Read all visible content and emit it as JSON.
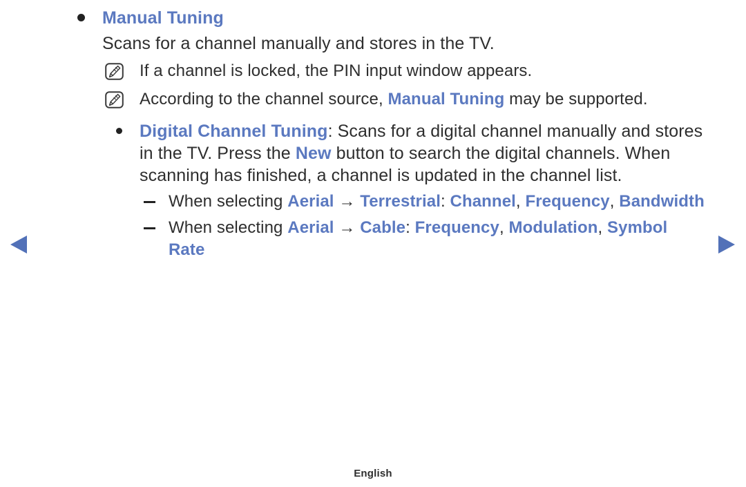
{
  "nav": {
    "prev_label": "previous-page",
    "next_label": "next-page",
    "arrow_color": "#5271b8"
  },
  "colors": {
    "accent_blue": "#5b79c0",
    "text_dark": "#2e2e2e",
    "background": "#ffffff"
  },
  "sections": {
    "manual_tuning": {
      "title": "Manual Tuning",
      "description": "Scans for a channel manually and stores in the TV.",
      "notes": [
        {
          "icon": "note-pencil-icon",
          "text": "If a channel is locked, the PIN input window appears."
        },
        {
          "icon": "note-pencil-icon",
          "text_before": "According to the channel source, ",
          "highlight": "Manual Tuning",
          "text_after": " may be supported."
        }
      ]
    },
    "digital_channel_tuning": {
      "heading": "Digital Channel Tuning",
      "colon": ":",
      "body_part1": " Scans for a digital channel manually and stores in the TV. Press the ",
      "button_name": "New",
      "body_part2": " button to search the digital channels. When scanning has finished, a channel is updated in the channel list.",
      "sub_items": [
        {
          "prefix": "When selecting ",
          "source": "Aerial",
          "arrow": "→",
          "target": "Terrestrial",
          "colon": ":",
          "options": [
            "Channel",
            "Frequency",
            "Bandwidth"
          ],
          "separator": ", "
        },
        {
          "prefix": "When selecting ",
          "source": "Aerial",
          "arrow": "→",
          "target": "Cable",
          "colon": ":",
          "options": [
            "Frequency",
            "Modulation",
            "Symbol Rate"
          ],
          "separator": ", "
        }
      ]
    }
  },
  "footer": {
    "language": "English"
  }
}
